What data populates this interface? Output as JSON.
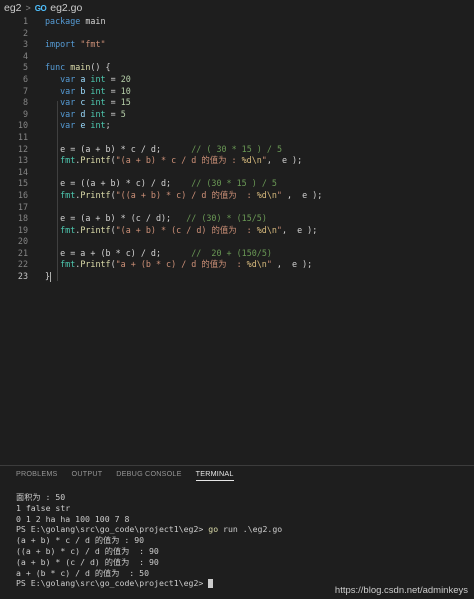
{
  "breadcrumb": {
    "folder": "eg2",
    "separator": ">",
    "icon": "go-file-icon",
    "icon_text": "GO",
    "file": "eg2.go"
  },
  "editor": {
    "line_numbers": [
      "1",
      "2",
      "3",
      "4",
      "5",
      "6",
      "7",
      "8",
      "9",
      "10",
      "11",
      "12",
      "13",
      "14",
      "15",
      "16",
      "17",
      "18",
      "19",
      "20",
      "21",
      "22",
      "23"
    ],
    "l1": [
      "package",
      " main"
    ],
    "l3": [
      "import",
      " ",
      "\"fmt\""
    ],
    "l5": [
      "func",
      " ",
      "main",
      "() {"
    ],
    "l6": [
      "var",
      " a ",
      "int",
      " = ",
      "20"
    ],
    "l7": [
      "var",
      " b ",
      "int",
      " = ",
      "10"
    ],
    "l8": [
      "var",
      " c ",
      "int",
      " = ",
      "15"
    ],
    "l9": [
      "var",
      " d ",
      "int",
      " = ",
      "5"
    ],
    "l10": [
      "var",
      " e ",
      "int",
      ";"
    ],
    "l12": [
      "e = (a + b) * c / d;",
      "// ( 30 * 15 ) / 5"
    ],
    "l13": [
      "fmt",
      ".",
      "Printf",
      "(",
      "\"(a + b) * c / d 的值为 : ",
      "%d\\n",
      "\"",
      ",  e );"
    ],
    "l15": [
      "e = ((a + b) * c) / d;",
      "// (30 * 15 ) / 5"
    ],
    "l16": [
      "fmt",
      ".",
      "Printf",
      "(",
      "\"((a + b) * c) / d 的值为  : ",
      "%d\\n",
      "\"",
      " ,  e );"
    ],
    "l18": [
      "e = (a + b) * (c / d);",
      "// (30) * (15/5)"
    ],
    "l19": [
      "fmt",
      ".",
      "Printf",
      "(",
      "\"(a + b) * (c / d) 的值为  : ",
      "%d\\n",
      "\"",
      ",  e );"
    ],
    "l21": [
      "e = a + (b * c) / d;",
      "//  20 + (150/5)"
    ],
    "l22": [
      "fmt",
      ".",
      "Printf",
      "(",
      "\"a + (b * c) / d 的值为  : ",
      "%d\\n",
      "\"",
      " ,  e );"
    ],
    "l23": [
      "}"
    ]
  },
  "panel": {
    "tabs": [
      "PROBLEMS",
      "OUTPUT",
      "DEBUG CONSOLE",
      "TERMINAL"
    ],
    "active_tab": "TERMINAL",
    "terminal": [
      "面积为 : 50",
      "1 false str",
      "0 1 2 ha ha 100 100 7 8",
      "(a + b) * c / d 的值为 : 90",
      "((a + b) * c) / d 的值为  : 90",
      "(a + b) * (c / d) 的值为  : 90",
      "a + (b * c) / d 的值为  : 50"
    ],
    "prompt": "PS E:\\golang\\src\\go_code\\project1\\eg2>",
    "cmd_go": "go",
    "cmd_rest": " run .\\eg2.go"
  },
  "watermark": "https://blog.csdn.net/adminkeys"
}
